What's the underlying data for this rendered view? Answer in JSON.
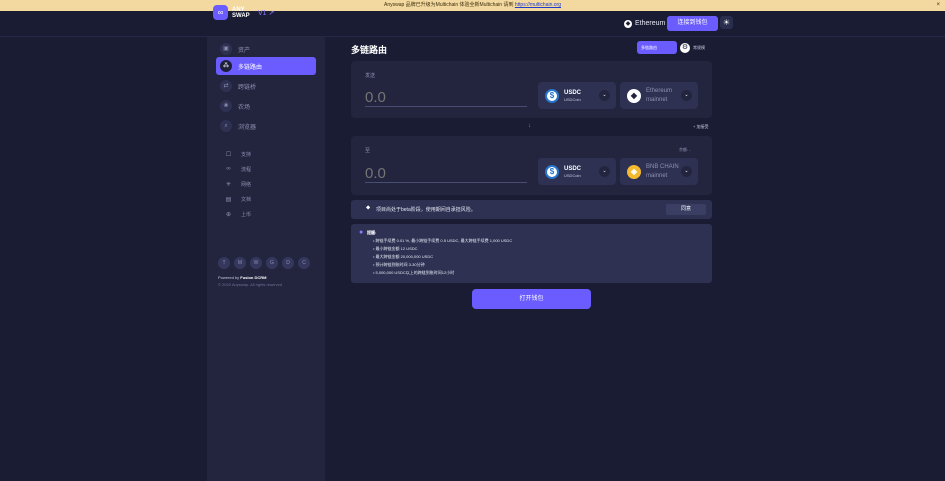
{
  "banner": {
    "text": "Anyswap 品牌已升级为Multichain 体验全新Multichain 请到",
    "link": "https://multichain.org",
    "close": "×"
  },
  "header": {
    "logo_text": "ANY SWAP",
    "version": "V1 ↗",
    "network": "Ethereum",
    "connect_label": "连接到钱包",
    "theme_icon": "sun-icon"
  },
  "sidebar": {
    "main_items": [
      {
        "label": "资产",
        "icon": "▣"
      },
      {
        "label": "多链路由",
        "icon": "⁂"
      },
      {
        "label": "跨链桥",
        "icon": "⇄"
      },
      {
        "label": "农场",
        "icon": "❀"
      },
      {
        "label": "浏览器",
        "icon": "⌕"
      }
    ],
    "sub_items": [
      {
        "label": "支持",
        "icon": "☐"
      },
      {
        "label": "流程",
        "icon": "∞"
      },
      {
        "label": "网络",
        "icon": "✳"
      },
      {
        "label": "文档",
        "icon": "▤"
      },
      {
        "label": "上币",
        "icon": "⊕"
      }
    ],
    "socials": [
      "T",
      "M",
      "W",
      "G",
      "D",
      "C"
    ],
    "powered_prefix": "Powered by",
    "powered_name": "Fusion DCRM",
    "copyright": "© 2020 Anyswap. All rights reserved"
  },
  "main": {
    "title": "多链路由",
    "mode_on": "多链路由",
    "mode_off": "常规模",
    "from": {
      "label": "发送",
      "amount": "0.0",
      "token_symbol": "USDC",
      "token_name": "USDCoin",
      "chain_line1": "Ethereum",
      "chain_line2": "mainnet"
    },
    "add_recipient": "+ 加接受",
    "to": {
      "label": "至",
      "balance": "余额: -",
      "amount": "0.0",
      "token_symbol": "USDC",
      "token_name": "USDCoin",
      "chain_line1": "BNB CHAIN",
      "chain_line2": "mainnet"
    },
    "notice": {
      "text": "项目尚处于beta阶段，使用期间自承担风险。",
      "button": "同意"
    },
    "tips": {
      "title": "提醒:",
      "items": [
        "跨链手续费 0.01 %, 最小跨链手续费 0.5 USDC, 最大跨链手续费 1,000 USDC",
        "最小跨链金额 12 USDC",
        "最大跨链金额 20,000,000 USDC",
        "预计跨链到账时间 3-30分钟",
        "5,000,000 USDC以上的跨链到账时间12小时"
      ]
    },
    "swap_button": "打开钱包"
  },
  "colors": {
    "accent": "#6b5cff",
    "background": "#1a1c33",
    "panel": "#23253f"
  }
}
